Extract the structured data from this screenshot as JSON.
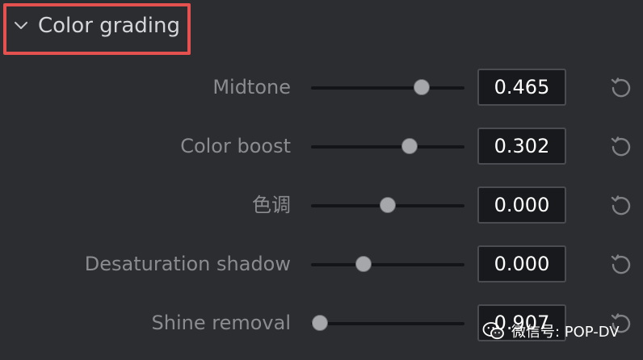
{
  "section": {
    "title": "Color grading",
    "collapse_icon": "chevron-down-icon"
  },
  "rows": [
    {
      "label": "Midtone",
      "value": "0.465",
      "slider_position": 0.72
    },
    {
      "label": "Color boost",
      "value": "0.302",
      "slider_position": 0.64
    },
    {
      "label": "色调",
      "value": "0.000",
      "slider_position": 0.5
    },
    {
      "label": "Desaturation shadow",
      "value": "0.000",
      "slider_position": 0.34
    },
    {
      "label": "Shine removal",
      "value": "0.907",
      "slider_position": 0.06
    }
  ],
  "watermark": {
    "text": "微信号: POP-DV",
    "logo": "wechat-logo"
  },
  "colors": {
    "background": "#2c2d31",
    "highlight": "#e5514f",
    "label_text": "#8b8c90",
    "value_text": "#ffffff"
  }
}
